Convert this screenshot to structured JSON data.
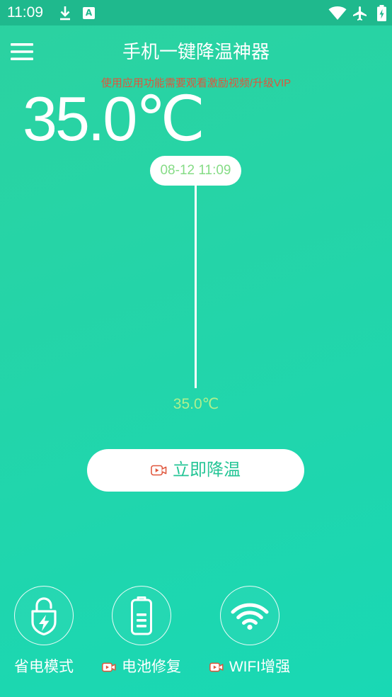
{
  "status_bar": {
    "time": "11:09",
    "app_icon_letter": "A",
    "left_icons": [
      "download-icon",
      "app-a-icon"
    ],
    "right_icons": [
      "wifi-signal-icon",
      "airplane-mode-icon",
      "battery-charging-icon"
    ]
  },
  "header": {
    "menu_icon": "hamburger-menu-icon",
    "title": "手机一键降温神器",
    "notice": "使用应用功能需要观看激励视频/升级VIP"
  },
  "temperature": {
    "current": "35.0℃"
  },
  "timeline": {
    "timestamp": "08-12 11:09",
    "reading": "35.0℃"
  },
  "cool_button": {
    "label": "立即降温",
    "icon": "video-ad-icon"
  },
  "features": [
    {
      "label": "省电模式",
      "icon": "lock-bolt-icon"
    },
    {
      "label": "电池修复",
      "icon": "battery-icon",
      "badge_icon": "video-ad-icon"
    },
    {
      "label": "WIFI增强",
      "icon": "wifi-icon",
      "badge_icon": "video-ad-icon"
    }
  ],
  "colors": {
    "status_bar": "#1fb98d",
    "background_top": "#2cd2a0",
    "background_bottom": "#19d8b4",
    "notice_text": "#e0553b",
    "timestamp_text": "#86dc86",
    "reading_text": "#aef08e",
    "button_text": "#25c596",
    "ad_icon": "#e0553b"
  }
}
